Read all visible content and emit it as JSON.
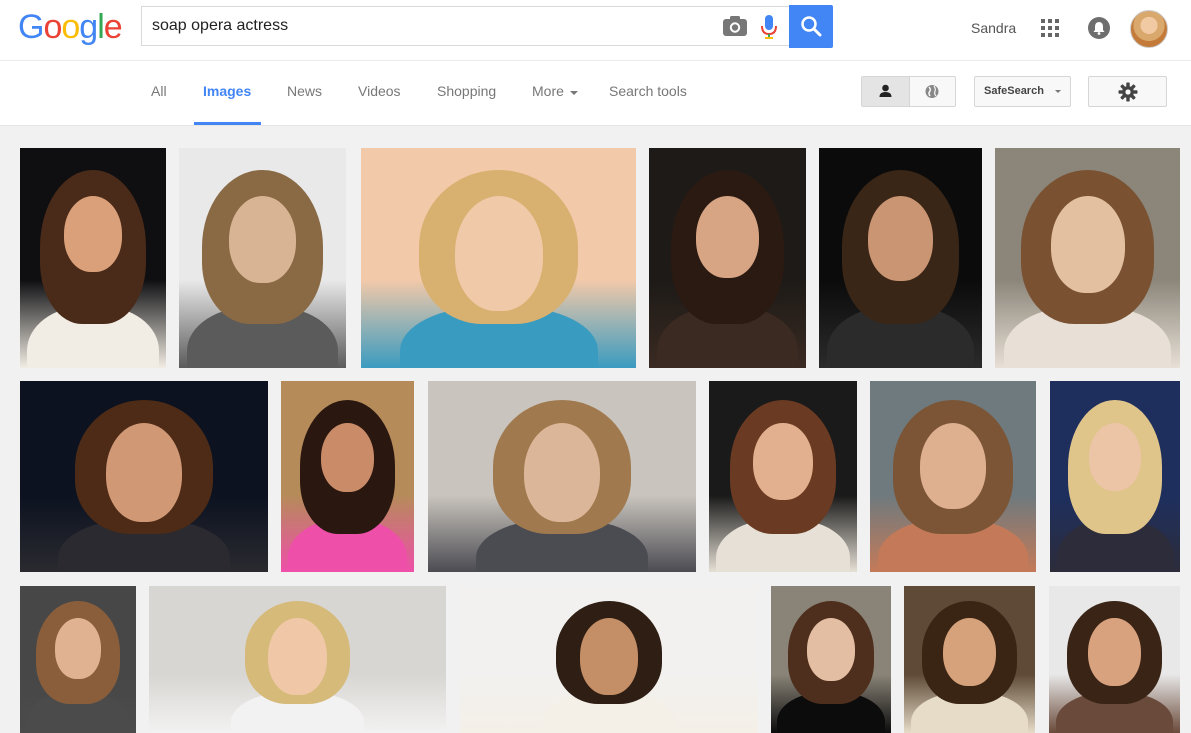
{
  "header": {
    "logo_text": "Google",
    "logo_letters": [
      {
        "ch": "G",
        "color": "#4285f4"
      },
      {
        "ch": "o",
        "color": "#ea4335"
      },
      {
        "ch": "o",
        "color": "#fbbc05"
      },
      {
        "ch": "g",
        "color": "#4285f4"
      },
      {
        "ch": "l",
        "color": "#34a853"
      },
      {
        "ch": "e",
        "color": "#ea4335"
      }
    ],
    "search_query": "soap opera actress",
    "user_name": "Sandra"
  },
  "nav": {
    "tabs": [
      {
        "label": "All",
        "active": false
      },
      {
        "label": "Images",
        "active": true
      },
      {
        "label": "News",
        "active": false
      },
      {
        "label": "Videos",
        "active": false
      },
      {
        "label": "Shopping",
        "active": false
      },
      {
        "label": "More",
        "active": false
      },
      {
        "label": "Search tools",
        "active": false
      }
    ],
    "safesearch_label": "SafeSearch",
    "icons": [
      "person-icon",
      "globe-icon",
      "gear-icon",
      "search-icon",
      "camera-icon",
      "microphone-icon",
      "apps-grid-icon",
      "notifications-icon"
    ]
  },
  "results": {
    "rows": [
      [
        {
          "bg": "#0f0f12",
          "hair": "#4a2a18",
          "skin": "#d9a07a",
          "top": "#f2ede4"
        },
        {
          "bg": "#e9e9e9",
          "hair": "#8a6a44",
          "skin": "#d8b494",
          "top": "#5b5b5b"
        },
        {
          "bg": "#f2c9a9",
          "hair": "#d8b070",
          "skin": "#f0caa8",
          "top": "#3a9bc0"
        },
        {
          "bg": "#1d1a17",
          "hair": "#2a1a12",
          "skin": "#d7a584",
          "top": "#3a2a22"
        },
        {
          "bg": "#0b0b0b",
          "hair": "#3a2616",
          "skin": "#c99573",
          "top": "#2b2b2b"
        },
        {
          "bg": "#8b857a",
          "hair": "#7a5232",
          "skin": "#e3c0a0",
          "top": "#e8e0d6"
        }
      ],
      [
        {
          "bg": "#0c1220",
          "hair": "#4d2b16",
          "skin": "#d19876",
          "top": "#2a2a30"
        },
        {
          "bg": "#b68b5a",
          "hair": "#2a1810",
          "skin": "#c98b68",
          "top": "#ee4fa9"
        },
        {
          "bg": "#c9c4bd",
          "hair": "#a07a4e",
          "skin": "#dcb698",
          "top": "#4b4b52"
        },
        {
          "bg": "#1a1a1a",
          "hair": "#6a3a22",
          "skin": "#e2b08e",
          "top": "#e6e0d6"
        },
        {
          "bg": "#6f7a7e",
          "hair": "#7b5536",
          "skin": "#deb090",
          "top": "#c47a58"
        },
        {
          "bg": "#1e2f5e",
          "hair": "#e0c58a",
          "skin": "#ecc4a6",
          "top": "#2c2c3a"
        }
      ],
      [
        {
          "bg": "#474747",
          "hair": "#8a5e3a",
          "skin": "#e0b292",
          "top": "#4b4b4b"
        },
        {
          "bg": "#d8d6d2",
          "hair": "#d6ba7a",
          "skin": "#f0c8a8",
          "top": "#f2f2f2"
        },
        {
          "bg": "#f2f1ef",
          "hair": "#2e1e14",
          "skin": "#c48e66",
          "top": "#f4f0e8"
        },
        {
          "bg": "#8a8478",
          "hair": "#4e2e1c",
          "skin": "#e4bea2",
          "top": "#0c0c0c"
        },
        {
          "bg": "#5e4a36",
          "hair": "#3a2414",
          "skin": "#d6a27c",
          "top": "#e6dcc8"
        },
        {
          "bg": "#e8e8e8",
          "hair": "#3a2416",
          "skin": "#d9a27e",
          "top": "#6a4a3a"
        }
      ]
    ]
  }
}
